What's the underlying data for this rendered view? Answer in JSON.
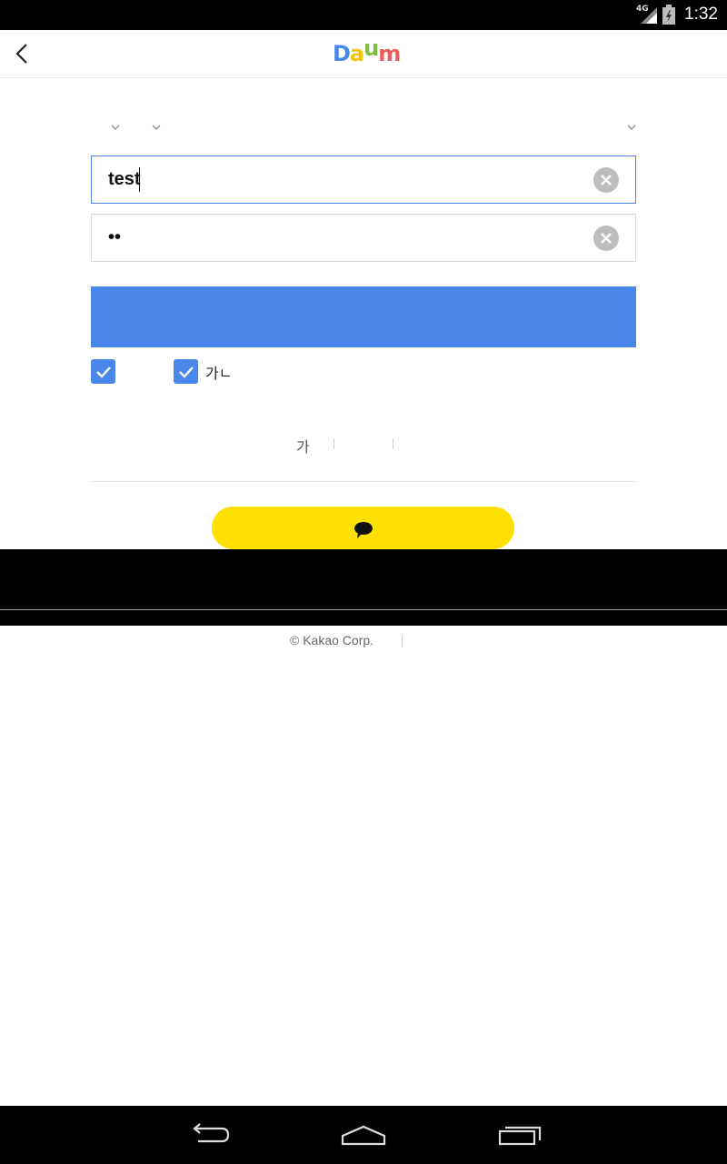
{
  "status_bar": {
    "time": "1:32",
    "network": "4G"
  },
  "header": {
    "logo_letters": [
      "D",
      "a",
      "u",
      "m"
    ],
    "logo_colors": [
      "#4a87ea",
      "#f5c400",
      "#7bc043",
      "#f05a5a"
    ]
  },
  "login_form": {
    "id_value": "test",
    "password_value": "••",
    "login_button_label": "",
    "keep_login_label": "",
    "secure_login_label": "가ㄴ"
  },
  "links": {
    "find_label": "가"
  },
  "kakao_button": {
    "label": "",
    "color": "#ffe000"
  },
  "footer": {
    "copyright": "© Kakao Corp."
  },
  "colors": {
    "accent": "#4a87ea",
    "kakao_yellow": "#ffe000"
  },
  "icons": [
    "back-arrow-icon",
    "chevron-down-icon",
    "clear-icon",
    "check-icon",
    "speech-bubble-icon",
    "nav-back-icon",
    "nav-home-icon",
    "nav-recents-icon",
    "signal-icon",
    "battery-icon"
  ]
}
